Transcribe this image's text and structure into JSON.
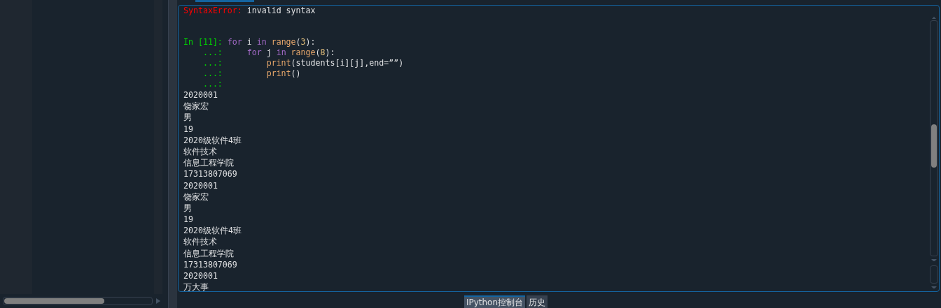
{
  "console": {
    "lines": [
      {
        "kind": "error",
        "name": "SyntaxError:",
        "message": "invalid syntax"
      },
      {
        "kind": "input",
        "prompt": "In [11]:",
        "tokens": [
          {
            "kind": "keyword",
            "text": "for"
          },
          {
            "kind": "plain",
            "text": " i "
          },
          {
            "kind": "keyword",
            "text": "in"
          },
          {
            "kind": "builtin",
            "text": " range"
          },
          {
            "kind": "plain",
            "text": "("
          },
          {
            "kind": "number",
            "text": "3"
          },
          {
            "kind": "plain",
            "text": "):"
          }
        ]
      },
      {
        "kind": "continuation",
        "prompt": "...:",
        "tokens": [
          {
            "kind": "keyword",
            "text": "    for"
          },
          {
            "kind": "plain",
            "text": " j "
          },
          {
            "kind": "keyword",
            "text": "in"
          },
          {
            "kind": "builtin",
            "text": " range"
          },
          {
            "kind": "plain",
            "text": "("
          },
          {
            "kind": "number",
            "text": "8"
          },
          {
            "kind": "plain",
            "text": "):"
          }
        ]
      },
      {
        "kind": "continuation",
        "prompt": "...:",
        "tokens": [
          {
            "kind": "builtin",
            "text": "        print"
          },
          {
            "kind": "plain",
            "text": "(students[i][j],end=””)"
          }
        ]
      },
      {
        "kind": "continuation",
        "prompt": "...:",
        "tokens": [
          {
            "kind": "builtin",
            "text": "        print"
          },
          {
            "kind": "plain",
            "text": "()"
          }
        ]
      },
      {
        "kind": "continuation",
        "prompt": "...:"
      },
      {
        "kind": "output",
        "text": "2020001"
      },
      {
        "kind": "output",
        "text": "饶家宏"
      },
      {
        "kind": "output",
        "text": "男"
      },
      {
        "kind": "output",
        "text": "19"
      },
      {
        "kind": "output",
        "text": "2020级软件4班"
      },
      {
        "kind": "output",
        "text": "软件技术"
      },
      {
        "kind": "output",
        "text": "信息工程学院"
      },
      {
        "kind": "output",
        "text": "17313807069"
      },
      {
        "kind": "output",
        "text": "2020001"
      },
      {
        "kind": "output",
        "text": "饶家宏"
      },
      {
        "kind": "output",
        "text": "男"
      },
      {
        "kind": "output",
        "text": "19"
      },
      {
        "kind": "output",
        "text": "2020级软件4班"
      },
      {
        "kind": "output",
        "text": "软件技术"
      },
      {
        "kind": "output",
        "text": "信息工程学院"
      },
      {
        "kind": "output",
        "text": "17313807069"
      },
      {
        "kind": "output",
        "text": "2020001"
      },
      {
        "kind": "output",
        "text": "万大事"
      }
    ]
  },
  "bottom_tabs": [
    {
      "label": "IPython控制台",
      "selected": true
    },
    {
      "label": "历史",
      "selected": false
    }
  ]
}
